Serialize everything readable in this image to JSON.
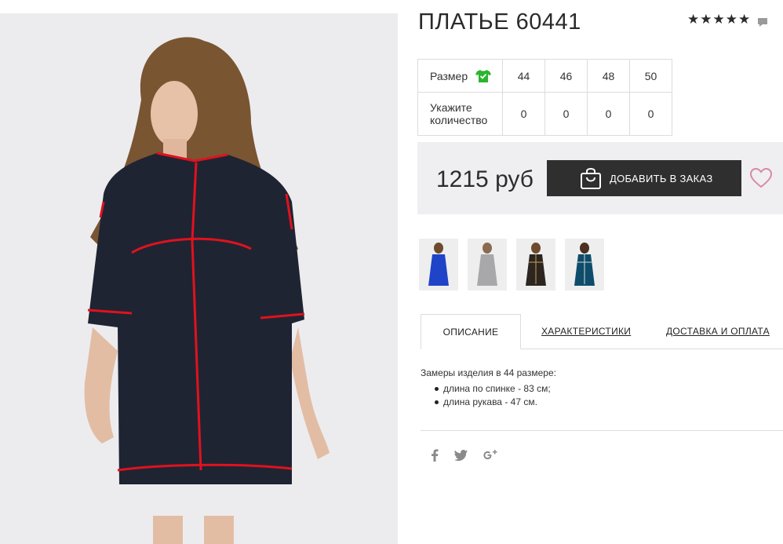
{
  "product": {
    "title": "ПЛАТЬЕ 60441",
    "rating_stars": 5
  },
  "size_table": {
    "size_label": "Размер",
    "quantity_label": "Укажите количество",
    "sizes": [
      "44",
      "46",
      "48",
      "50"
    ],
    "quantities": [
      "0",
      "0",
      "0",
      "0"
    ]
  },
  "purchase": {
    "price": "1215 руб",
    "add_button_label": "ДОБАВИТЬ В ЗАКАЗ"
  },
  "tabs": [
    {
      "label": "ОПИСАНИЕ",
      "active": true
    },
    {
      "label": "ХАРАКТЕРИСТИКИ",
      "active": false
    },
    {
      "label": "ДОСТАВКА И ОПЛАТА",
      "active": false
    }
  ],
  "description": {
    "intro": "Замеры изделия в 44 размере:",
    "items": [
      "длина по спинке - 83 см;",
      "длина рукава - 47 см."
    ]
  },
  "colors": {
    "dress_main": "#1f2433",
    "piping": "#e0121d",
    "size_icon": "#2ab52e",
    "heart": "#d98aa0",
    "button_bg": "#2f2f2f",
    "thumb_colors": [
      "#1f44c8",
      "#a8a8ab",
      "#2c2520",
      "#0d4d6b"
    ]
  },
  "icons": {
    "rating": "star-icon",
    "comment": "comment-icon",
    "size_guide": "tshirt-check-icon",
    "bag": "shopping-bag-icon",
    "wishlist": "heart-icon",
    "social": [
      "facebook-icon",
      "twitter-icon",
      "google-plus-icon"
    ]
  }
}
